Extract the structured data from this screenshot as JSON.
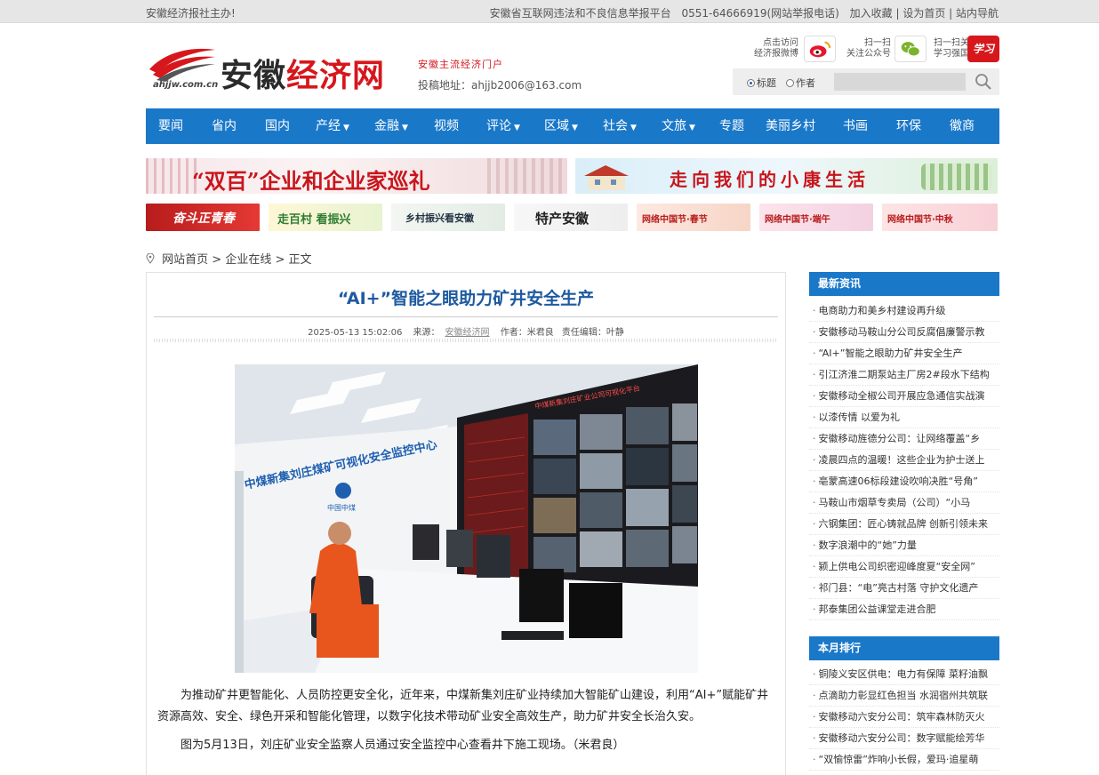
{
  "topbar": {
    "left": "安徽经济报社主办!",
    "links": [
      "安徽省互联网违法和不良信息举报平台",
      "0551-64666919(网站举报电话)",
      "加入收藏 | 设为首页 | 站内导航"
    ]
  },
  "header": {
    "logo_name_a": "安徽",
    "logo_name_b": "经济网",
    "logo_domain": "ahjjw.com.cn",
    "slogan": "安徽主流经济门户",
    "email": "投稿地址：ahjjb2006@163.com",
    "weibo_label": "点击访问\n经济报微博",
    "wechat_label": "扫一扫\n关注公众号",
    "xuexi_label": "扫一扫关注\n学习强国号",
    "xuexi_badge": "学习",
    "search": {
      "opt_title": "标题",
      "opt_author": "作者"
    }
  },
  "nav": [
    "要闻",
    "省内",
    "国内",
    "产经",
    "金融",
    "视频",
    "评论",
    "区域",
    "社会",
    "文旅",
    "专题",
    "美丽乡村",
    "书画",
    "环保",
    "徽商"
  ],
  "nav_dropdown": [
    "产经",
    "金融",
    "评论",
    "区域",
    "社会",
    "文旅"
  ],
  "banners": {
    "big1": "“双百”企业和企业家巡礼",
    "big2": "走向我们的小康生活",
    "small": [
      "奋斗正青春",
      "走百村 看振兴",
      "乡村振兴看安徽",
      "特产安徽",
      "网络中国节·春节",
      "网络中国节·端午",
      "网络中国节·中秋"
    ]
  },
  "breadcrumb": [
    "网站首页",
    "企业在线",
    "正文"
  ],
  "article": {
    "title": "“AI+”智能之眼助力矿井安全生产",
    "datetime": "2025-05-13 15:02:06",
    "source_label": "来源：",
    "source": "安徽经济网",
    "author": "作者：米君良",
    "editor": "责任编辑：叶静",
    "photo_wall_text": "中煤新集刘庄煤矿可视化安全监控中心",
    "photo_wall_logo": "中国中煤",
    "photo_screen_text": "中煤新集刘庄矿业公司可视化平台",
    "p1": "为推动矿井更智能化、人员防控更安全化，近年来，中煤新集刘庄矿业持续加大智能矿山建设，利用“AI+”赋能矿井资源高效、安全、绿色开采和智能化管理，以数字化技术带动矿业安全高效生产，助力矿井安全长治久安。",
    "p2": "图为5月13日，刘庄矿业安全监察人员通过安全监控中心查看井下施工现场。（米君良）"
  },
  "sidebar": {
    "latest_title": "最新资讯",
    "latest": [
      "电商助力和美乡村建设再升级",
      "安徽移动马鞍山分公司反腐倡廉警示教",
      "“AI+”智能之眼助力矿井安全生产",
      "引江济淮二期泵站主厂房2#段水下结构",
      "安徽移动全椒公司开展应急通信实战演",
      "以漆传情 以爱为礼",
      "安徽移动旌德分公司：让网络覆盖“乡",
      "凌晨四点的温暖！这些企业为护士送上",
      "亳蒙高速06标段建设吹响决胜“号角”",
      "马鞍山市烟草专卖局（公司）“小马",
      "六钢集团：匠心铸就品牌 创新引领未来",
      "数字浪潮中的“她”力量",
      "颍上供电公司织密迎峰度夏“安全网”",
      "祁门县：“电”亮古村落 守护文化遗产",
      "邦泰集团公益课堂走进合肥"
    ],
    "monthly_title": "本月排行",
    "monthly": [
      "铜陵义安区供电：电力有保障 菜籽油飘",
      "点滴助力彰显红色担当 水润宿州共筑联",
      "安徽移动六安分公司：筑牢森林防灭火",
      "安徽移动六安分公司：数字赋能绘芳华",
      "“双愉惊雷”炸响小长假，爱玛·追星萌"
    ]
  }
}
